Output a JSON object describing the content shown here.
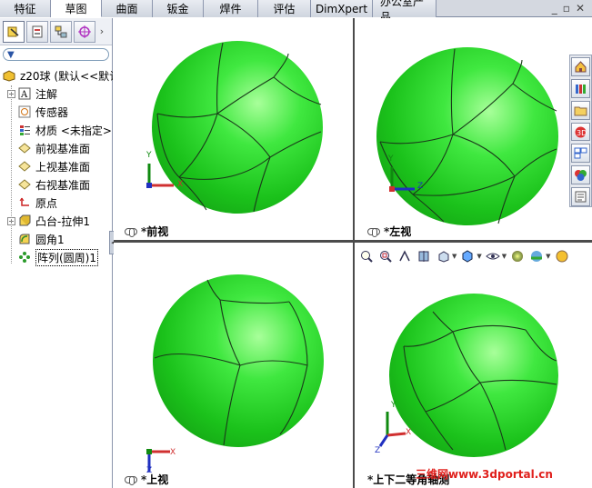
{
  "tabs": [
    {
      "label": "特征",
      "active": false
    },
    {
      "label": "草图",
      "active": true
    },
    {
      "label": "曲面",
      "active": false
    },
    {
      "label": "钣金",
      "active": false
    },
    {
      "label": "焊件",
      "active": false
    },
    {
      "label": "评估",
      "active": false
    },
    {
      "label": "DimXpert",
      "active": false
    },
    {
      "label": "办公室产品",
      "active": false
    }
  ],
  "window_controls": {
    "minimize": "_",
    "restore": "▫",
    "close": "✕"
  },
  "panel_tools": {
    "icons": [
      "feature-manager-icon",
      "property-manager-icon",
      "configuration-manager-icon",
      "dimxpert-manager-icon"
    ],
    "more": "›"
  },
  "filter": {
    "icon": "▼"
  },
  "tree": {
    "root": "z20球 (默认<<默认>",
    "items": [
      {
        "label": "注解",
        "icon": "A",
        "expandable": true
      },
      {
        "label": "传感器",
        "icon": "◎",
        "expandable": false
      },
      {
        "label": "材质 <未指定>",
        "icon": "☰",
        "expandable": false
      },
      {
        "label": "前视基准面",
        "icon": "◇",
        "expandable": false
      },
      {
        "label": "上视基准面",
        "icon": "◇",
        "expandable": false
      },
      {
        "label": "右视基准面",
        "icon": "◇",
        "expandable": false
      },
      {
        "label": "原点",
        "icon": "↳",
        "expandable": false
      },
      {
        "label": "凸台-拉伸1",
        "icon": "▣",
        "expandable": true
      },
      {
        "label": "圆角1",
        "icon": "◍",
        "expandable": false
      },
      {
        "label": "阵列(圆周)1",
        "icon": "✱",
        "expandable": false
      }
    ],
    "expand_symbol": "+"
  },
  "views": {
    "top_left": "*前视",
    "top_right": "*左视",
    "bottom_left": "*上视",
    "bottom_right": "*上下二等角轴测"
  },
  "axis_labels": {
    "x": "X",
    "y": "Y",
    "z": "Z"
  },
  "taskpane": [
    "home-icon",
    "library-icon",
    "folder-icon",
    "sketch-3d-icon",
    "view-palette-icon",
    "appearance-icon",
    "custom-properties-icon"
  ],
  "hud": [
    "zoom-fit-icon",
    "zoom-area-icon",
    "previous-view-icon",
    "section-view-icon",
    "view-orientation-icon",
    "display-style-icon",
    "hide-show-icon",
    "edit-appearance-icon",
    "apply-scene-icon",
    "view-settings-icon"
  ],
  "watermark": "三维网www.3dportal.cn",
  "colors": {
    "sphere": "#1fc41f",
    "axis_x": "#d03030",
    "axis_y": "#108a10",
    "axis_z": "#2030c0",
    "watermark": "#e0201c"
  }
}
